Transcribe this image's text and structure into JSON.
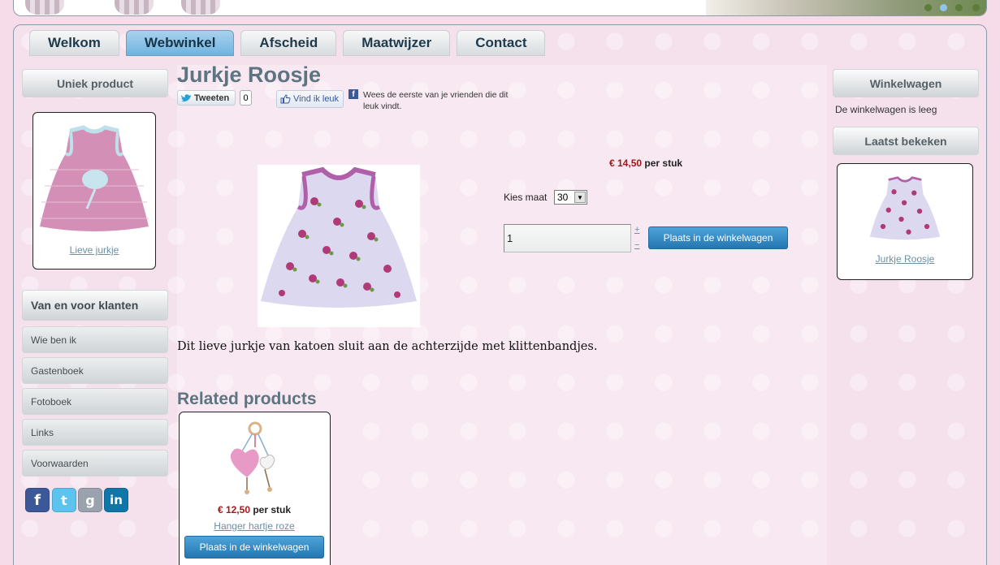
{
  "nav": {
    "tabs": [
      {
        "label": "Welkom",
        "active": false
      },
      {
        "label": "Webwinkel",
        "active": true
      },
      {
        "label": "Afscheid",
        "active": false
      },
      {
        "label": "Maatwijzer",
        "active": false
      },
      {
        "label": "Contact",
        "active": false
      }
    ]
  },
  "left_sidebar": {
    "unique_heading": "Uniek product",
    "unique_product_link": "Lieve jurkje",
    "customers_heading": "Van en voor klanten",
    "menu": [
      "Wie ben ik",
      "Gastenboek",
      "Fotoboek",
      "Links",
      "Voorwaarden"
    ],
    "social_icons": [
      "facebook-icon",
      "twitter-icon",
      "google-icon",
      "linkedin-icon"
    ]
  },
  "product": {
    "title": "Jurkje Roosje",
    "tweet_label": "Tweeten",
    "tweet_count": "0",
    "like_label": "Vind ik leuk",
    "facebook_text": "Wees de eerste van je vrienden die dit leuk vindt.",
    "price_amount": "€ 14,50",
    "price_unit": "per stuk",
    "size_label": "Kies maat",
    "size_value": "30",
    "quantity": "1",
    "qty_plus": "+",
    "qty_minus": "−",
    "add_to_cart": "Plaats in de winkelwagen",
    "description": "Dit lieve jurkje van katoen sluit aan de achterzijde met klittenbandjes."
  },
  "related": {
    "heading": "Related products",
    "items": [
      {
        "price_amount": "€ 12,50",
        "price_unit": "per stuk",
        "name": "Hanger hartje roze",
        "button": "Plaats in de winkelwagen"
      }
    ]
  },
  "right_sidebar": {
    "cart_heading": "Winkelwagen",
    "cart_empty": "De winkelwagen is leeg",
    "recent_heading": "Laatst bekeken",
    "recent_product_link": "Jurkje Roosje"
  },
  "colors": {
    "accent_blue": "#2f86c3",
    "price_red": "#a01818",
    "heading_slate": "#5e7481",
    "background_pink": "#f6dbe8"
  }
}
